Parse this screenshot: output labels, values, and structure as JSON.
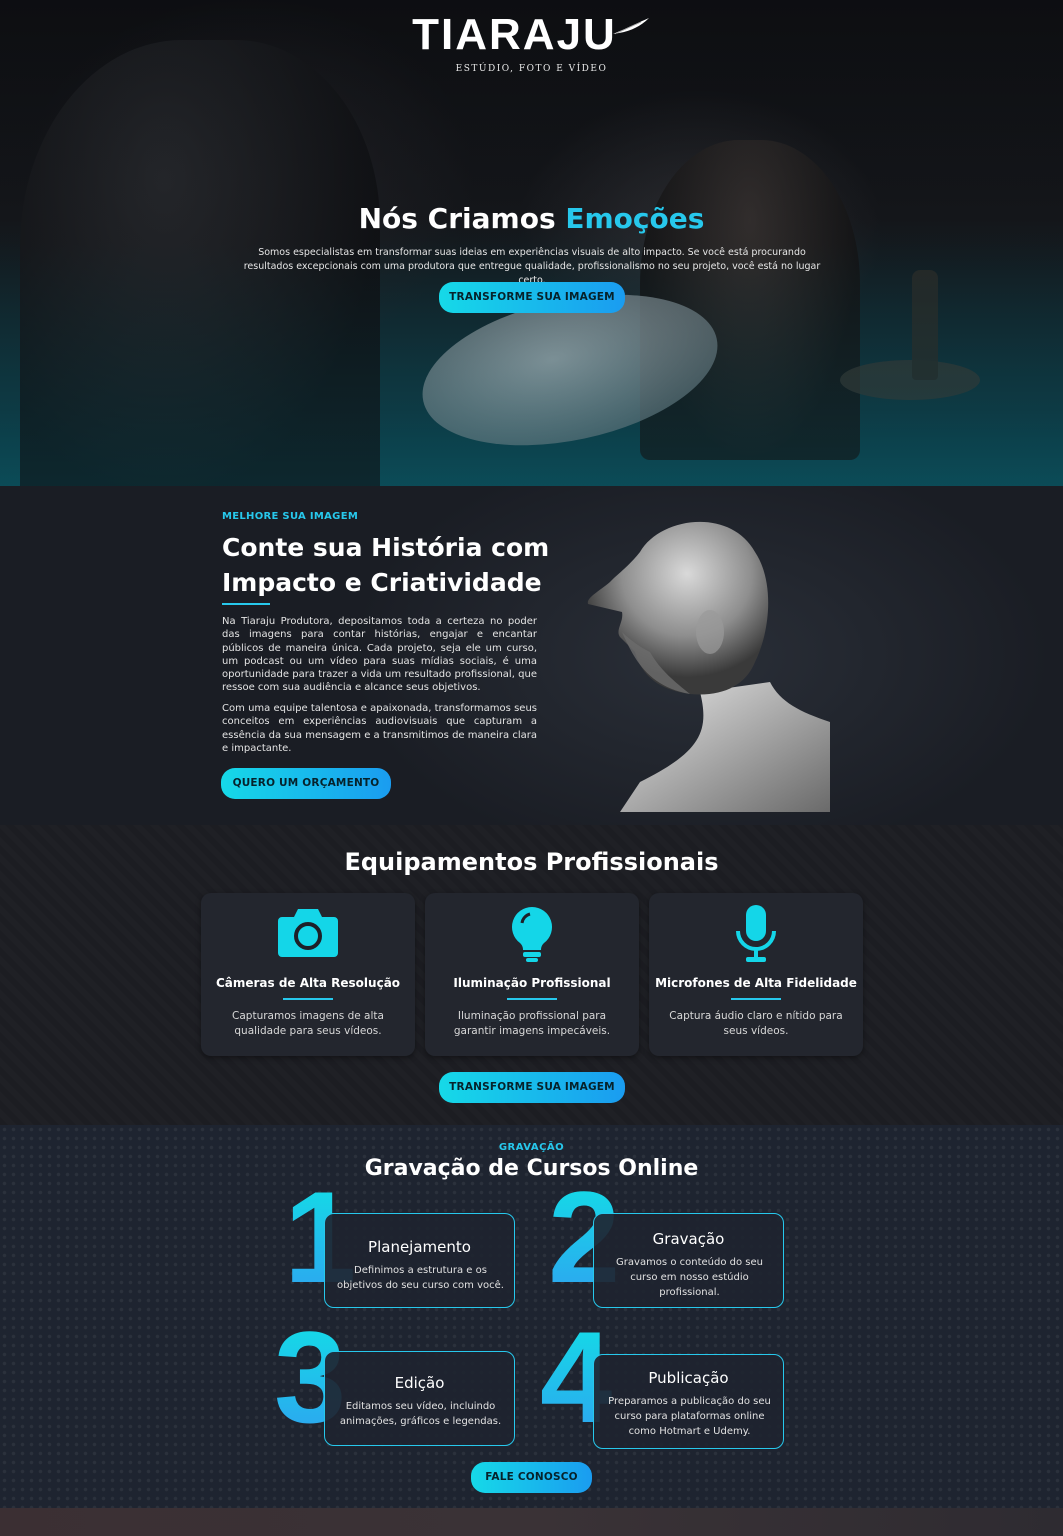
{
  "header": {
    "brand": "TIARAJU",
    "tagline": "ESTÚDIO, FOTO E VÍDEO"
  },
  "hero": {
    "title_part1": "Nós Criamos ",
    "title_accent": "Emoções",
    "subtitle": "Somos especialistas em transformar suas ideias em experiências visuais de alto impacto. Se você está procurando resultados excepcionais com uma produtora que entregue qualidade, profissionalismo no seu projeto, você está no lugar certo.",
    "button_label": "TRANSFORME SUA IMAGEM"
  },
  "about": {
    "kicker": "MELHORE SUA IMAGEM",
    "title": "Conte sua História com Impacto e Criatividade",
    "paragraph1": "Na Tiaraju Produtora, depositamos toda a certeza no poder das imagens para contar histórias, engajar e encantar públicos de maneira única. Cada projeto, seja ele um curso, um podcast ou um vídeo para suas mídias sociais, é uma oportunidade para trazer a vida um resultado profissional, que ressoe com sua audiência e alcance seus objetivos.",
    "paragraph2": "Com uma equipe talentosa e apaixonada, transformamos seus conceitos em experiências audiovisuais que capturam a essência da sua mensagem e a transmitimos de maneira clara e impactante.",
    "button_label": "QUERO UM ORÇAMENTO"
  },
  "equipment": {
    "title": "Equipamentos Profissionais",
    "cards": [
      {
        "icon": "camera-icon",
        "title": "Câmeras de Alta Resolução",
        "description": "Capturamos imagens de alta qualidade para seus vídeos."
      },
      {
        "icon": "lightbulb-icon",
        "title": "Iluminação Profissional",
        "description": "Iluminação profissional para garantir imagens impecáveis."
      },
      {
        "icon": "microphone-icon",
        "title": "Microfones de Alta Fidelidade",
        "description": "Captura áudio claro e nítido para seus vídeos."
      }
    ],
    "button_label": "TRANSFORME SUA IMAGEM"
  },
  "courses": {
    "kicker": "GRAVAÇÃO",
    "title": "Gravação de Cursos Online",
    "steps": [
      {
        "number": "1",
        "title": "Planejamento",
        "description": "Definimos a estrutura e os objetivos do seu curso com você."
      },
      {
        "number": "2",
        "title": "Gravação",
        "description": "Gravamos o conteúdo do seu curso em nosso estúdio profissional."
      },
      {
        "number": "3",
        "title": "Edição",
        "description": "Editamos seu vídeo, incluindo animações, gráficos e legendas."
      },
      {
        "number": "4",
        "title": "Publicação",
        "description": "Preparamos a publicação do seu curso para plataformas online como Hotmart e Udemy."
      }
    ],
    "button_label": "FALE CONOSCO"
  },
  "colors": {
    "accent": "#27c8ec",
    "button_gradient_start": "#16d9e8",
    "button_gradient_end": "#1a9cf0",
    "card_bg": "#23262e"
  }
}
